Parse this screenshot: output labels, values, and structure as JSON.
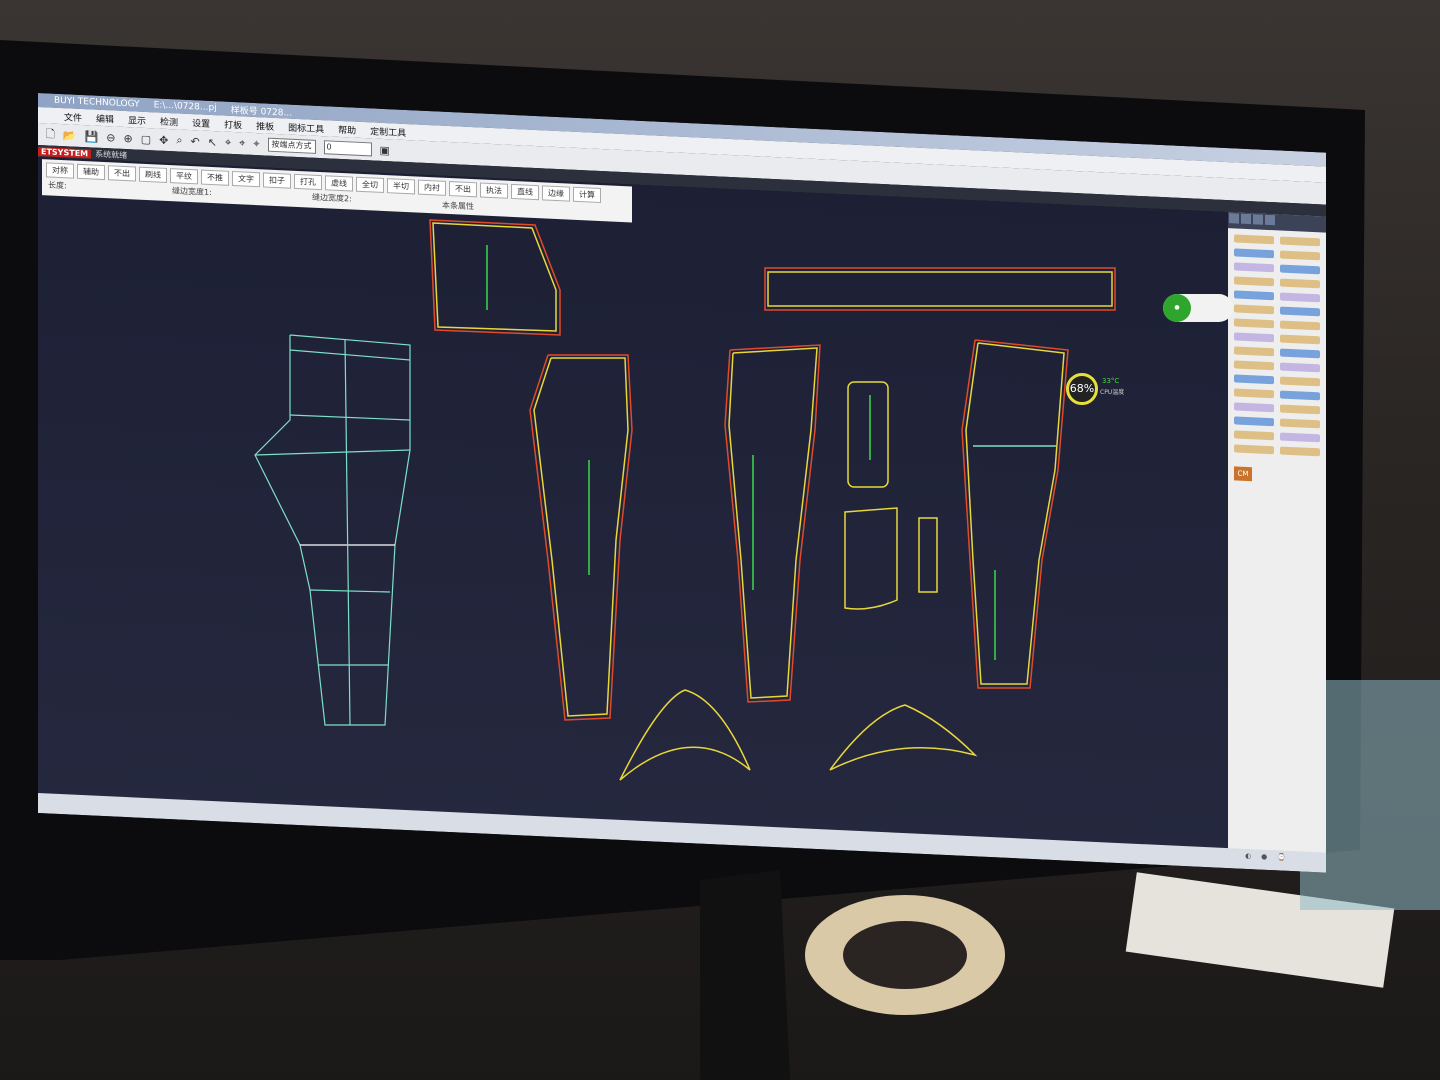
{
  "window": {
    "app_title": "BUYI TECHNOLOGY",
    "file_path": "E:\\...\\0728...pj",
    "pattern_no": "样板号 0728..."
  },
  "menu": [
    "文件",
    "编辑",
    "显示",
    "检测",
    "设置",
    "打板",
    "推板",
    "图标工具",
    "帮助",
    "定制工具"
  ],
  "toolbar": {
    "mode_select": "按端点方式",
    "value_field": "0"
  },
  "status": {
    "brand": "ETSYSTEM",
    "text": "系统就绪"
  },
  "tool_buttons": [
    "对称",
    "辅助",
    "不出",
    "刷线",
    "平纹",
    "不推",
    "文字",
    "扣子",
    "打孔",
    "虚线",
    "全切",
    "半切",
    "内衬",
    "不出",
    "执法",
    "直线",
    "边缘",
    "计算"
  ],
  "field_labels": {
    "length": "长度:",
    "seam1": "缝边宽度1:",
    "seam2": "缝边宽度2:",
    "attr": "本条属性"
  },
  "right_panel": {
    "cm_label": "CM"
  },
  "cpu_widget": {
    "usage": "68%",
    "temperature": "33°C",
    "label": "CPU温度"
  },
  "colors": {
    "canvas": "#1f2238",
    "seam_outer": "#e8d73a",
    "seam_inner": "#e04a2a",
    "grain_line": "#3ad94a",
    "draft_line": "#7ee0c8"
  }
}
